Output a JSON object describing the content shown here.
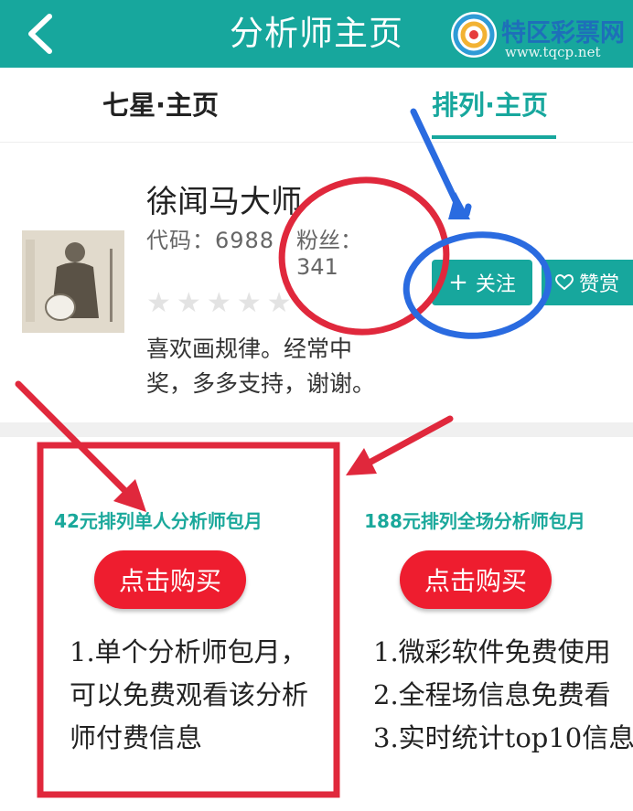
{
  "header": {
    "title": "分析师主页",
    "back_icon": "chevron-left-icon",
    "logo": {
      "text": "特区彩票网",
      "subtext": "www.tqcp.net"
    }
  },
  "tabs": [
    {
      "label": "七星·主页",
      "active": false
    },
    {
      "label": "排列·主页",
      "active": true
    }
  ],
  "profile": {
    "name": "徐闻马大师",
    "code_label": "代码：",
    "code": "6988",
    "fans_label": "粉丝：",
    "fans": "341",
    "rating": 0,
    "rating_max": 5,
    "description_lines": [
      "喜欢画规律。经常中",
      "奖，多多支持，谢谢。"
    ],
    "follow_label": "关注",
    "reward_label": "赞赏"
  },
  "packages": [
    {
      "title": "42元排列单人分析师包月",
      "button": "点击购买",
      "lines": [
        "1.单个分析师包月，",
        "可以免费观看该分析",
        "师付费信息"
      ]
    },
    {
      "title": "188元排列全场分析师包月",
      "button": "点击购买",
      "lines": [
        "1.微彩软件免费使用",
        "2.全程场信息免费看",
        "3.实时统计top10信息"
      ]
    }
  ],
  "colors": {
    "accent": "#17a79d",
    "buy_button": "#ee1d2f",
    "annotation_red": "#e0283c",
    "annotation_blue": "#2a6be0"
  }
}
